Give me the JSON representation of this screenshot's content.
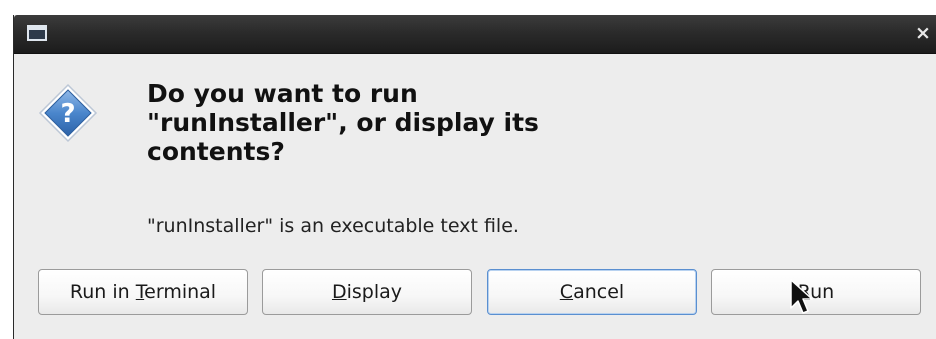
{
  "dialog": {
    "headline": "Do you want to run\n\"runInstaller\", or display its\ncontents?",
    "message": "\"runInstaller\" is an executable text file.",
    "close_glyph": "×",
    "icon": "question-icon"
  },
  "buttons": {
    "run_in_terminal": {
      "before": "Run in ",
      "mnemonic": "T",
      "after": "erminal"
    },
    "display": {
      "before": "",
      "mnemonic": "D",
      "after": "isplay"
    },
    "cancel": {
      "before": "",
      "mnemonic": "C",
      "after": "ancel"
    },
    "run": {
      "before": "",
      "mnemonic": "R",
      "after": "un"
    }
  },
  "colors": {
    "titlebar": "#2b2b2b",
    "dialog_bg": "#ededed",
    "icon_blue": "#3f7cc4",
    "focus_border": "#5a8fd0"
  }
}
